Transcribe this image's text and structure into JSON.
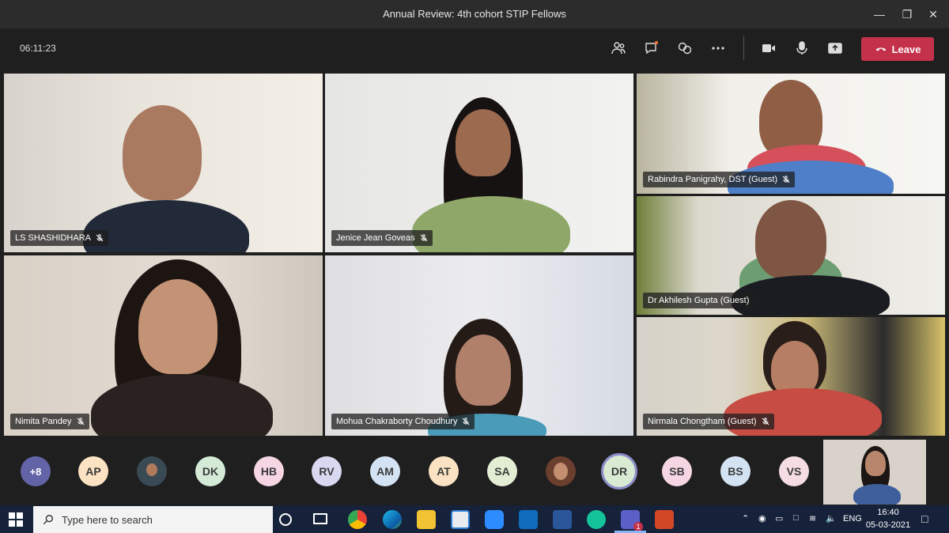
{
  "window": {
    "title": "Annual Review: 4th cohort STIP Fellows"
  },
  "toolbar": {
    "timer": "06:11:23",
    "leave_label": "Leave"
  },
  "participants": [
    {
      "name": "LS SHASHIDHARA"
    },
    {
      "name": "Jenice Jean Goveas"
    },
    {
      "name": "Rabindra Panigrahy, DST (Guest)"
    },
    {
      "name": "Dr Akhilesh Gupta (Guest)"
    },
    {
      "name": "Nimita Pandey"
    },
    {
      "name": "Mohua Chakraborty Choudhury"
    },
    {
      "name": "Nirmala Chongtham (Guest)"
    }
  ],
  "roster": {
    "overflow": "+8",
    "avatars": [
      "AP",
      "DK",
      "HB",
      "RV",
      "AM",
      "AT",
      "SA",
      "DR",
      "SB",
      "BS",
      "VS"
    ]
  },
  "taskbar": {
    "search_placeholder": "Type here to search",
    "language": "ENG",
    "time": "16:40",
    "date": "05-03-2021",
    "teams_badge": "1"
  }
}
